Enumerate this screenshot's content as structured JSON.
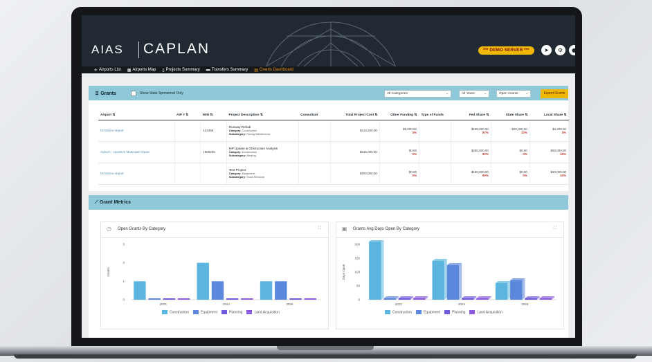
{
  "brand": {
    "logo_left": "AIAS",
    "logo_right": "CAPLAN"
  },
  "badge": "*** DEMO SERVER ***",
  "top_icons": [
    "rocket-icon",
    "gears-icon",
    "user-icon"
  ],
  "nav": [
    {
      "label": "Airports List",
      "icon": "plane-icon"
    },
    {
      "label": "Airports Map",
      "icon": "map-icon"
    },
    {
      "label": "Projects Summary",
      "icon": "document-icon"
    },
    {
      "label": "Transfers Summary",
      "icon": "card-icon"
    },
    {
      "label": "Grants Dashboard",
      "icon": "grants-icon",
      "active": true
    }
  ],
  "grants": {
    "title": "Grants",
    "checkbox_label": "Show State Sponsored Only",
    "filters": [
      "All Categories",
      "All Years",
      "Open Grants"
    ],
    "export": "Export Grants",
    "columns": [
      "Airport ⇅",
      "AIP # ⇅",
      "WIN ⇅",
      "Project Description ⇅",
      "Consultant",
      "Total Project Cost ⇅",
      "Other Funding ⇅",
      "Type of Funds",
      "Fed Share ⇅",
      "State Share ⇅",
      "Local Share ⇅"
    ],
    "rows": [
      {
        "airport": "MJ Demo Airport",
        "aip": "",
        "win": "123456",
        "desc": "Runway Rehab",
        "category": "Construction",
        "subcategory": "Paving Maintenance",
        "consultant": "",
        "total": "$214,200.00",
        "other": "$5,000.00",
        "other_pct": "3%",
        "type": "",
        "fed": "$185,000.00",
        "fed_pct": "87%",
        "state": "$20,000.00",
        "state_pct": "10%",
        "local": "$4,200.00",
        "local_pct": "3%"
      },
      {
        "airport": "Auburn - Lewiston Municipal Airport",
        "aip": "",
        "win": "1869405",
        "desc": "MP Update & Obstruction Analysis",
        "category": "Construction",
        "subcategory": "Marking",
        "consultant": "",
        "total": "$315,000.00",
        "other": "$0.00",
        "other_pct": "0%",
        "type": "",
        "fed": "$250,000.00",
        "fed_pct": "90%",
        "state": "$0.00",
        "state_pct": "0%",
        "local": "$50,000.00",
        "local_pct": "16%"
      },
      {
        "airport": "MJ Demo Airport",
        "aip": "",
        "win": "",
        "desc": "Test Project",
        "category": "Equipment",
        "subcategory": "Snow Removal",
        "consultant": "",
        "total": "$200,000.00",
        "other": "$0.00",
        "other_pct": "0%",
        "type": "",
        "fed": "$180,000.00",
        "fed_pct": "90%",
        "state": "$0.00",
        "state_pct": "0%",
        "local": "$20,000.00",
        "local_pct": "10%"
      }
    ],
    "category_label": "Category:",
    "subcategory_label": "Subcategory:"
  },
  "metrics": {
    "title": "Grant Metrics"
  },
  "colors": {
    "Construction": "#5bb5de",
    "Equipment": "#5b87dd",
    "Planning": "#6f5bdd",
    "Land Acquisition": "#8c5bdd"
  },
  "chart_data": [
    {
      "type": "bar",
      "title": "Open Grants By Category",
      "ylabel": "Grants",
      "ylim": [
        0,
        3
      ],
      "yticks": [
        "0",
        "1",
        "2",
        "3"
      ],
      "categories": [
        "2023",
        "2024",
        "2026"
      ],
      "series": [
        {
          "name": "Construction",
          "values": [
            1,
            2,
            1
          ]
        },
        {
          "name": "Equipment",
          "values": [
            0,
            1,
            1
          ]
        },
        {
          "name": "Planning",
          "values": [
            0,
            0,
            0
          ]
        },
        {
          "name": "Land Acquisition",
          "values": [
            0,
            0,
            0
          ]
        }
      ]
    },
    {
      "type": "bar",
      "title": "Grants Avg Days Open By Category",
      "ylabel": "Days Open",
      "ylim": [
        0,
        200
      ],
      "yticks": [
        "0",
        "50",
        "100",
        "150",
        "200"
      ],
      "categories": [
        "2023",
        "2024",
        "2026"
      ],
      "series": [
        {
          "name": "Construction",
          "values": [
            210,
            140,
            60
          ]
        },
        {
          "name": "Equipment",
          "values": [
            0,
            125,
            70
          ]
        },
        {
          "name": "Planning",
          "values": [
            0,
            0,
            0
          ]
        },
        {
          "name": "Land Acquisition",
          "values": [
            0,
            0,
            0
          ]
        }
      ]
    }
  ]
}
